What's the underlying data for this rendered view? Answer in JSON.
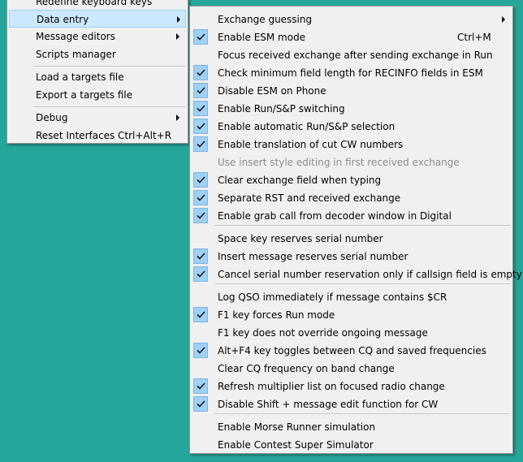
{
  "left_menu": {
    "items": [
      {
        "label": "Redefine keyboard keys"
      },
      {
        "label": "Data entry"
      },
      {
        "label": "Message editors"
      },
      {
        "label": "Scripts manager"
      },
      {
        "label": "Load a targets file"
      },
      {
        "label": "Export a targets file"
      },
      {
        "label": "Debug"
      },
      {
        "label": "Reset Interfaces",
        "shortcut": "Ctrl+Alt+R"
      }
    ]
  },
  "right_menu": {
    "items": [
      {
        "label": "Exchange guessing",
        "checked": false
      },
      {
        "label": "Enable ESM mode",
        "shortcut": "Ctrl+M",
        "checked": true
      },
      {
        "label": "Focus received exchange after sending exchange in Run",
        "checked": false
      },
      {
        "label": "Check minimum field length for RECINFO fields in ESM",
        "checked": true
      },
      {
        "label": "Disable ESM on Phone",
        "checked": true
      },
      {
        "label": "Enable Run/S&P switching",
        "checked": true
      },
      {
        "label": "Enable automatic Run/S&P selection",
        "checked": true
      },
      {
        "label": "Enable translation of cut CW numbers",
        "checked": true
      },
      {
        "label": "Use insert style editing in first received exchange",
        "checked": false,
        "disabled": true
      },
      {
        "label": "Clear exchange field when typing",
        "checked": true
      },
      {
        "label": "Separate RST and received exchange",
        "checked": true
      },
      {
        "label": "Enable grab call from decoder window in Digital",
        "checked": true
      },
      {
        "label": "Space key reserves serial number",
        "checked": false
      },
      {
        "label": "Insert message reserves serial number",
        "checked": true
      },
      {
        "label": "Cancel serial number reservation only if callsign field is empty",
        "checked": true
      },
      {
        "label": "Log QSO immediately if message contains $CR",
        "checked": false
      },
      {
        "label": "F1 key forces Run mode",
        "checked": true
      },
      {
        "label": "F1 key does not override ongoing message",
        "checked": false
      },
      {
        "label": "Alt+F4 key toggles between CQ and saved frequencies",
        "checked": true
      },
      {
        "label": "Clear CQ frequency on band change",
        "checked": false
      },
      {
        "label": "Refresh multiplier list on focused radio change",
        "checked": true
      },
      {
        "label": "Disable Shift + message edit function for CW",
        "checked": true
      },
      {
        "label": "Enable Morse Runner simulation",
        "checked": false
      },
      {
        "label": "Enable Contest Super Simulator",
        "checked": false
      }
    ]
  },
  "colors": {
    "desktop": "#26A69A",
    "menu_bg": "#f0f0f0",
    "highlight": "#cce8ff",
    "check_bg": "#9fd0f5"
  }
}
